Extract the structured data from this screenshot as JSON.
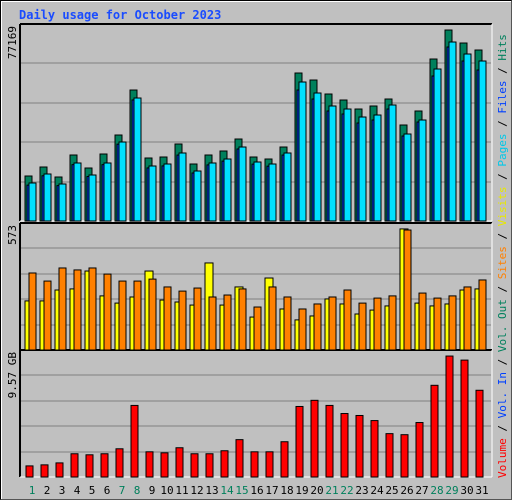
{
  "title": "Daily usage for October 2023",
  "colors": {
    "background": "#c0c0c0",
    "title": "#1a4cff",
    "hits": "#00805c",
    "files": "#0040ff",
    "pages": "#00e0ff",
    "visits": "#ffff00",
    "sites": "#ff8000",
    "volume": "#ff0000",
    "kbin": "#0040ff",
    "kbout": "#00805c",
    "weekend": "#00805c",
    "weekday": "#000000",
    "grid": "#808080"
  },
  "chart_data": [
    {
      "type": "bar",
      "title": "Daily usage for October 2023",
      "panel": "hits-files-pages",
      "ymax_label": "77169",
      "ylim": [
        0,
        77169
      ],
      "grid": true,
      "categories": [
        "1",
        "2",
        "3",
        "4",
        "5",
        "6",
        "7",
        "8",
        "9",
        "10",
        "11",
        "12",
        "13",
        "14",
        "15",
        "16",
        "17",
        "18",
        "19",
        "20",
        "21",
        "22",
        "23",
        "24",
        "25",
        "26",
        "27",
        "28",
        "29",
        "30",
        "31"
      ],
      "series": [
        {
          "name": "Hits",
          "values": [
            17807,
            21368,
            17411,
            26117,
            20973,
            26513,
            34031,
            51838,
            24930,
            25326,
            30470,
            22555,
            26117,
            27700,
            32448,
            25326,
            24534,
            29282,
            58566,
            55796,
            50256,
            47882,
            44320,
            45508,
            48278,
            37989,
            43529,
            64106,
            75582,
            70438,
            67668
          ]
        },
        {
          "name": "Files",
          "values": [
            15037,
            18599,
            14641,
            22952,
            18203,
            22952,
            31262,
            48673,
            21764,
            22556,
            26909,
            19786,
            22952,
            24534,
            29282,
            23347,
            22556,
            26909,
            55005,
            50652,
            45508,
            44320,
            41154,
            41945,
            45903,
            34427,
            39967,
            60148,
            70833,
            66084,
            63314
          ]
        },
        {
          "name": "Pages",
          "values": [
            14200,
            17900,
            14000,
            22300,
            17600,
            22300,
            30400,
            47900,
            21000,
            21800,
            26100,
            19000,
            22200,
            23700,
            28500,
            22500,
            21700,
            26100,
            51838,
            48278,
            43529,
            42341,
            38780,
            39967,
            44320,
            33636,
            39175,
            57378,
            68855,
            63314,
            59753
          ]
        }
      ]
    },
    {
      "type": "bar",
      "panel": "visits-sites",
      "ymax_label": "573",
      "ylim": [
        0,
        573
      ],
      "grid": true,
      "categories": [
        "1",
        "2",
        "3",
        "4",
        "5",
        "6",
        "7",
        "8",
        "9",
        "10",
        "11",
        "12",
        "13",
        "14",
        "15",
        "16",
        "17",
        "18",
        "19",
        "20",
        "21",
        "22",
        "23",
        "24",
        "25",
        "26",
        "27",
        "28",
        "29",
        "30",
        "31"
      ],
      "series": [
        {
          "name": "Visits",
          "values": [
            225,
            225,
            275,
            280,
            362,
            248,
            215,
            243,
            362,
            229,
            220,
            206,
            399,
            206,
            289,
            151,
            330,
            188,
            138,
            156,
            234,
            211,
            165,
            183,
            202,
            555,
            215,
            202,
            211,
            275,
            280
          ]
        },
        {
          "name": "Sites",
          "values": [
            353,
            316,
            376,
            367,
            376,
            348,
            316,
            316,
            325,
            289,
            270,
            284,
            243,
            252,
            280,
            197,
            289,
            243,
            188,
            211,
            243,
            275,
            215,
            238,
            248,
            550,
            261,
            238,
            248,
            289,
            321
          ]
        }
      ]
    },
    {
      "type": "bar",
      "panel": "volume",
      "ymax_label": "9.57 GB",
      "ylim": [
        0,
        9.57
      ],
      "unit": "GB",
      "grid": true,
      "categories": [
        "1",
        "2",
        "3",
        "4",
        "5",
        "6",
        "7",
        "8",
        "9",
        "10",
        "11",
        "12",
        "13",
        "14",
        "15",
        "16",
        "17",
        "18",
        "19",
        "20",
        "21",
        "22",
        "23",
        "24",
        "25",
        "26",
        "27",
        "28",
        "29",
        "30",
        "31"
      ],
      "series": [
        {
          "name": "Volume",
          "values": [
            0.85,
            0.93,
            1.08,
            1.78,
            1.7,
            1.78,
            2.16,
            5.48,
            1.93,
            1.85,
            2.24,
            1.78,
            1.78,
            2.01,
            2.86,
            1.93,
            1.93,
            2.7,
            5.4,
            5.87,
            5.48,
            4.86,
            4.71,
            4.32,
            3.32,
            3.24,
            4.17,
            7.02,
            9.26,
            8.95,
            6.64
          ]
        }
      ]
    }
  ],
  "legend": [
    {
      "label": "Volume",
      "color": "#ff0000"
    },
    {
      "label": " / ",
      "color": "#000000"
    },
    {
      "label": "Vol. In",
      "color": "#0040ff"
    },
    {
      "label": " / ",
      "color": "#000000"
    },
    {
      "label": "Vol. Out",
      "color": "#00805c"
    },
    {
      "label": " / ",
      "color": "#000000"
    },
    {
      "label": "Sites",
      "color": "#ff8000"
    },
    {
      "label": " / ",
      "color": "#000000"
    },
    {
      "label": "Visits",
      "color": "#e8e800"
    },
    {
      "label": " / ",
      "color": "#000000"
    },
    {
      "label": "Pages",
      "color": "#00c8e8"
    },
    {
      "label": " / ",
      "color": "#000000"
    },
    {
      "label": "Files",
      "color": "#0040ff"
    },
    {
      "label": " / ",
      "color": "#000000"
    },
    {
      "label": "Hits",
      "color": "#00805c"
    }
  ],
  "weekend_days": [
    1,
    7,
    8,
    14,
    15,
    21,
    22,
    28,
    29
  ]
}
